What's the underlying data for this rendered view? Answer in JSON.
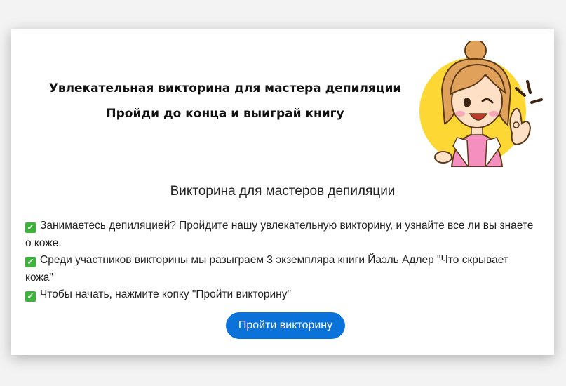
{
  "header": {
    "title": "Увлекательная викторина для мастера депиляции",
    "subtitle": "Пройди до конца и выиграй книгу"
  },
  "illustration": {
    "icon": "girl-ok-gesture-illustration",
    "bg_color": "#fdd835",
    "accent_color": "#f58fbf"
  },
  "quiz": {
    "title": "Викторина для мастеров депиляции",
    "check_icon": "check-mark-icon",
    "items": [
      "Занимаетесь депиляцией? Пройдите нашу увлекательную викторину, и узнайте все ли вы знаете о коже.",
      "Среди участников викторины мы разыграем 3 экземпляра книги Йаэль Адлер \"Что скрывает кожа\"",
      "Чтобы начать, нажмите копку \"Пройти викторину\""
    ],
    "button_label": "Пройти викторину",
    "button_color": "#0b72d9"
  }
}
